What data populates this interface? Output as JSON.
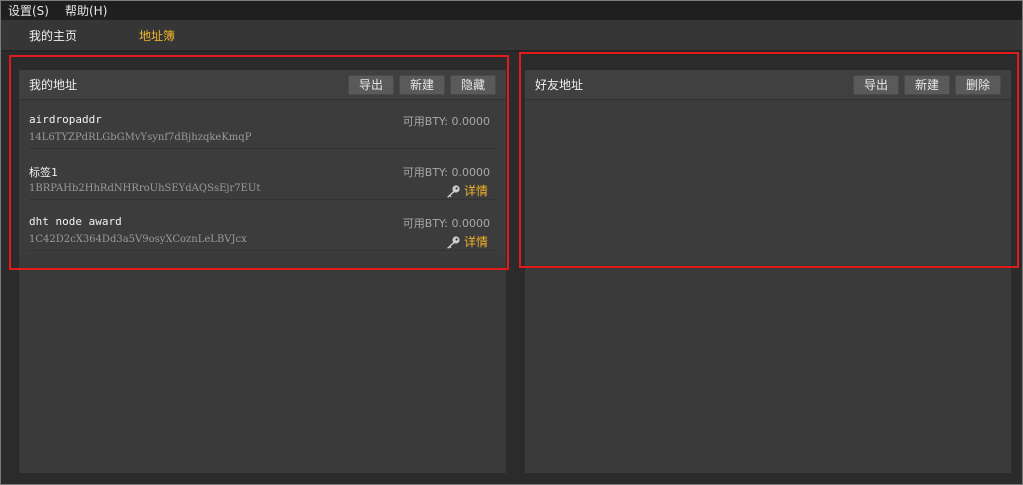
{
  "menu": {
    "items": [
      {
        "label": "设置(S)"
      },
      {
        "label": "帮助(H)"
      }
    ]
  },
  "tabs": {
    "home": "我的主页",
    "addressbook": "地址簿"
  },
  "my_addresses": {
    "title": "我的地址",
    "buttons": {
      "export": "导出",
      "new": "新建",
      "hide": "隐藏"
    },
    "rows": [
      {
        "label": "airdropaddr",
        "address": "14L6TYZPdRLGbGMvYsynf7dBjhzqkeKmqP",
        "balance": "可用BTY: 0.0000",
        "detail": ""
      },
      {
        "label": "标签1",
        "address": "1BRPAHb2HhRdNHRroUhSEYdAQSsEjr7EUt",
        "balance": "可用BTY: 0.0000",
        "detail": "详情"
      },
      {
        "label": "dht node award",
        "address": "1C42D2cX364Dd3a5V9osyXCoznLeLBVJcx",
        "balance": "可用BTY: 0.0000",
        "detail": "详情"
      }
    ]
  },
  "friend_addresses": {
    "title": "好友地址",
    "buttons": {
      "export": "导出",
      "new": "新建",
      "delete": "删除"
    }
  },
  "colors": {
    "accent": "#f0b429",
    "highlight_box": "#e01b1b",
    "background": "#2b2b2b"
  },
  "icons": {
    "detail_icon": "key-icon"
  }
}
